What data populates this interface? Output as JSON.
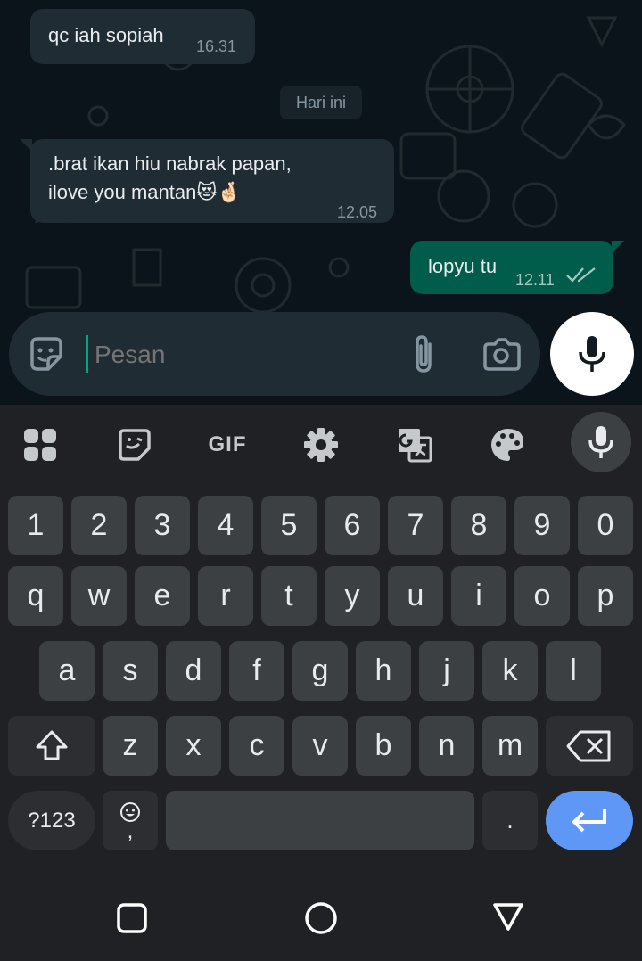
{
  "chat": {
    "messages": [
      {
        "direction": "in",
        "text": "qc iah sopiah",
        "time": "16.31"
      },
      {
        "direction": "in",
        "text_line1": ".brat ikan hiu nabrak papan,",
        "text_line2": "ilove you mantan😻🤞🏻",
        "time": "12.05"
      },
      {
        "direction": "out",
        "text": "lopyu tu",
        "time": "12.11",
        "status": "read-double-check-icon"
      }
    ],
    "date_separator": "Hari ini"
  },
  "composer": {
    "placeholder": "Pesan",
    "icons": [
      "sticker-emoji-icon",
      "attach-paperclip-icon",
      "camera-icon",
      "mic-icon"
    ]
  },
  "keyboard": {
    "toolbar_icons": [
      "apps-grid-icon",
      "sticker-icon",
      "gif-icon",
      "settings-gear-icon",
      "translate-icon",
      "palette-icon",
      "voice-mic-icon"
    ],
    "gif_label": "GIF",
    "number_row": [
      "1",
      "2",
      "3",
      "4",
      "5",
      "6",
      "7",
      "8",
      "9",
      "0"
    ],
    "row1": [
      "q",
      "w",
      "e",
      "r",
      "t",
      "y",
      "u",
      "i",
      "o",
      "p"
    ],
    "row2": [
      "a",
      "s",
      "d",
      "f",
      "g",
      "h",
      "j",
      "k",
      "l"
    ],
    "row3": [
      "z",
      "x",
      "c",
      "v",
      "b",
      "n",
      "m"
    ],
    "symbols_label": "?123",
    "comma_label": ",",
    "period_label": ".",
    "shift_icon": "shift-arrow-icon",
    "backspace_icon": "backspace-icon",
    "enter_icon": "enter-return-icon",
    "emoji_key_icon": "smiley-icon"
  },
  "navbar": {
    "icons": [
      "recents-square-icon",
      "home-circle-icon",
      "back-triangle-icon"
    ]
  },
  "colors": {
    "chat_bg": "#0b141a",
    "incoming_bubble": "#202c33",
    "outgoing_bubble": "#005c4b",
    "keyboard_bg": "#202124",
    "key_bg": "#3c4043",
    "enter_key": "#5e97f6"
  }
}
